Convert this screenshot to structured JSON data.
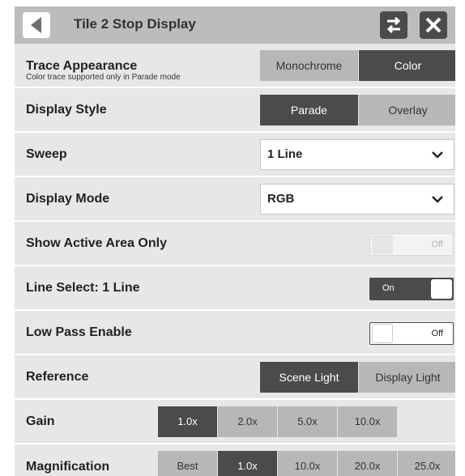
{
  "header": {
    "title": "Tile 2 Stop Display"
  },
  "trace_appearance": {
    "label": "Trace Appearance",
    "sublabel": "Color trace supported only in Parade mode",
    "options": [
      "Monochrome",
      "Color"
    ],
    "selected": "Color"
  },
  "display_style": {
    "label": "Display Style",
    "options": [
      "Parade",
      "Overlay"
    ],
    "selected": "Parade"
  },
  "sweep": {
    "label": "Sweep",
    "value": "1 Line"
  },
  "display_mode": {
    "label": "Display Mode",
    "value": "RGB"
  },
  "show_active_area": {
    "label": "Show Active Area Only",
    "state": "Off",
    "enabled": false
  },
  "line_select": {
    "label": "Line Select: 1 Line",
    "state": "On"
  },
  "low_pass": {
    "label": "Low Pass Enable",
    "state": "Off"
  },
  "reference": {
    "label": "Reference",
    "options": [
      "Scene Light",
      "Display Light"
    ],
    "selected": "Scene Light"
  },
  "gain": {
    "label": "Gain",
    "options": [
      "1.0x",
      "2.0x",
      "5.0x",
      "10.0x"
    ],
    "selected": "1.0x"
  },
  "magnification": {
    "label": "Magnification",
    "options": [
      "Best",
      "1.0x",
      "10.0x",
      "20.0x",
      "25.0x"
    ],
    "selected": "1.0x"
  },
  "colors": {
    "accent": "#4b4b4b",
    "panel": "#e7e7e7",
    "header": "#bcbcbc",
    "inactive": "#b7b7b7"
  }
}
